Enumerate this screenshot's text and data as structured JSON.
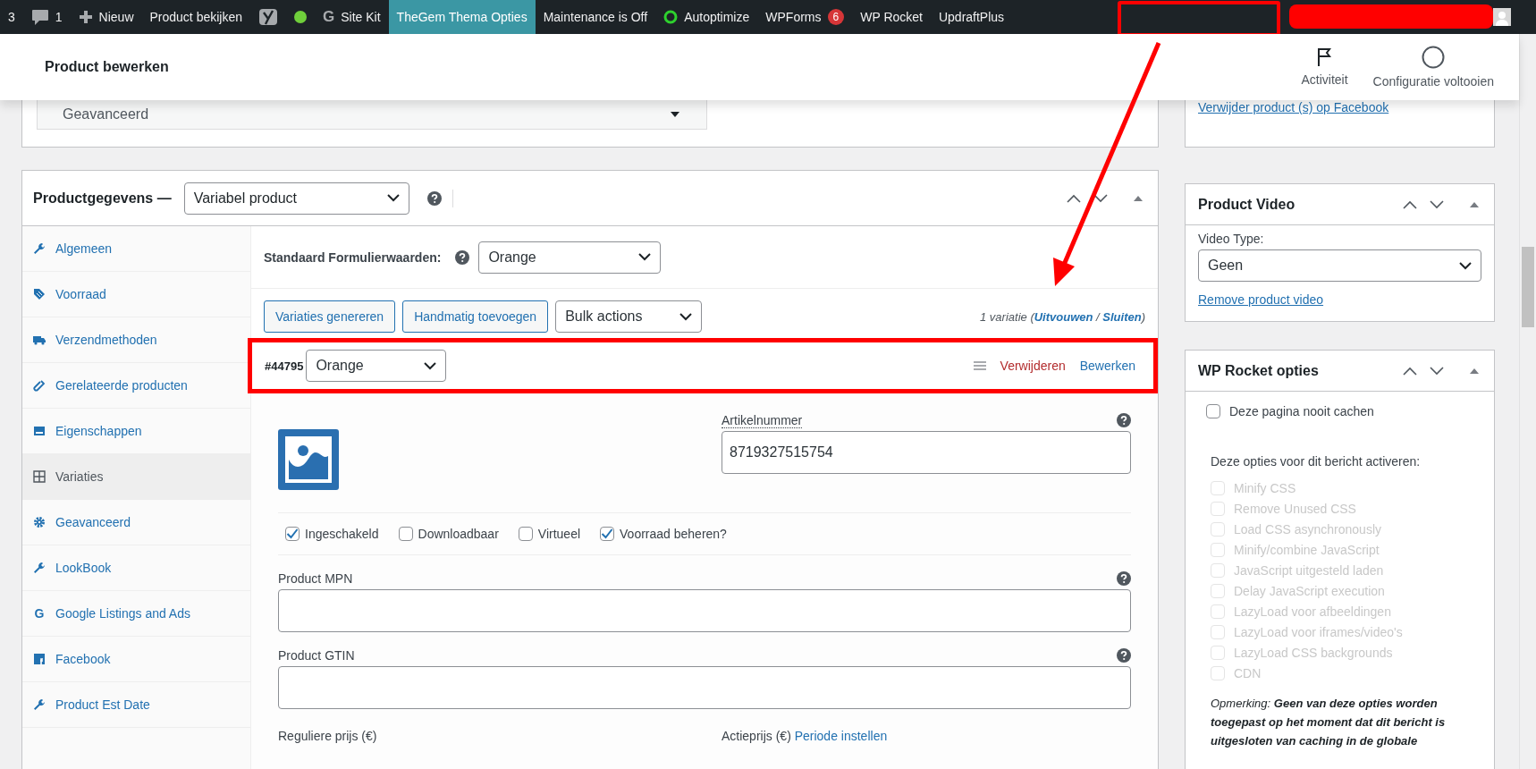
{
  "admin_bar": {
    "items": [
      {
        "kind": "text",
        "label": "3",
        "selected": false
      },
      {
        "kind": "comments",
        "label": "1",
        "selected": false
      },
      {
        "kind": "new",
        "label": "Nieuw",
        "selected": false
      },
      {
        "kind": "text",
        "label": "Product bekijken",
        "selected": false
      },
      {
        "kind": "logo",
        "selected": false
      },
      {
        "kind": "dot",
        "color": "#6fcf3b",
        "selected": false
      },
      {
        "kind": "glyph",
        "glyph": "G",
        "label": "Site Kit",
        "selected": false
      },
      {
        "kind": "text",
        "label": "TheGem Thema Opties",
        "selected": true
      },
      {
        "kind": "text",
        "label": "Maintenance is Off",
        "selected": false
      },
      {
        "kind": "ring",
        "label": "Autoptimize",
        "selected": false
      },
      {
        "kind": "badge",
        "label": "WPForms",
        "badge": "6",
        "selected": false
      },
      {
        "kind": "text",
        "label": "WP Rocket",
        "selected": false
      },
      {
        "kind": "text",
        "label": "UpdraftPlus",
        "selected": false
      }
    ]
  },
  "header": {
    "title": "Product bewerken",
    "actions": [
      {
        "kind": "flag",
        "label": "Activiteit"
      },
      {
        "kind": "progress",
        "label": "Configuratie voltooien"
      }
    ]
  },
  "top_select": {
    "value": "Geavanceerd"
  },
  "facebook_box": {
    "link": "Verwijder product (s) op Facebook"
  },
  "product_data": {
    "title": "Productgegevens —",
    "type_value": "Variabel product",
    "tabs": [
      {
        "kind": "wrench",
        "label": "Algemeen",
        "selected": false
      },
      {
        "kind": "tag",
        "label": "Voorraad",
        "selected": false
      },
      {
        "kind": "truck",
        "label": "Verzendmethoden",
        "selected": false
      },
      {
        "kind": "link",
        "label": "Gerelateerde producten",
        "selected": false
      },
      {
        "kind": "card",
        "label": "Eigenschappen",
        "selected": false
      },
      {
        "kind": "grid",
        "label": "Variaties",
        "selected": true
      },
      {
        "kind": "gear",
        "label": "Geavanceerd",
        "selected": false
      },
      {
        "kind": "wrench",
        "label": "LookBook",
        "selected": false
      },
      {
        "kind": "glyph",
        "glyph": "G",
        "label": "Google Listings and Ads",
        "selected": false
      },
      {
        "kind": "square",
        "label": "Facebook",
        "selected": false
      },
      {
        "kind": "wrench",
        "label": "Product Est Date",
        "selected": false
      }
    ],
    "defaults_label": "Standaard Formulierwaarden:",
    "defaults_value": "Orange",
    "buttons": [
      "Variaties genereren",
      "Handmatig toevoegen"
    ],
    "bulk_value": "Bulk actions",
    "count": {
      "text": "1 variatie (",
      "expand": "Uitvouwen",
      "separator": " / ",
      "collapse": "Sluiten",
      "end": ")"
    },
    "variation": {
      "id": "#44795",
      "value": "Orange",
      "remove": "Verwijderen",
      "edit": "Bewerken",
      "sku_label": "Artikelnummer",
      "sku": "8719327515754",
      "options": [
        {
          "label": "Ingeschakeld",
          "checked": true
        },
        {
          "label": "Downloadbaar",
          "checked": false
        },
        {
          "label": "Virtueel",
          "checked": false
        },
        {
          "label": "Voorraad beheren?",
          "checked": true
        }
      ],
      "fields": [
        {
          "label": "Product MPN"
        },
        {
          "label": "Product GTIN"
        }
      ],
      "regular_price_label": "Reguliere prijs (€)",
      "sale_price_label": "Actieprijs (€)",
      "schedule_link": "Periode instellen"
    }
  },
  "product_video": {
    "title": "Product Video",
    "label": "Video Type:",
    "value": "Geen",
    "link": "Remove product video"
  },
  "wp_rocket": {
    "title": "WP Rocket opties",
    "never_cache": {
      "label": "Deze pagina nooit cachen",
      "checked": false
    },
    "intro": "Deze opties voor dit bericht activeren:",
    "options": [
      {
        "label": "Minify CSS",
        "checked": false,
        "disabled": true
      },
      {
        "label": "Remove Unused CSS",
        "checked": false,
        "disabled": true
      },
      {
        "label": "Load CSS asynchronously",
        "checked": false,
        "disabled": true
      },
      {
        "label": "Minify/combine JavaScript",
        "checked": false,
        "disabled": true
      },
      {
        "label": "JavaScript uitgesteld laden",
        "checked": false,
        "disabled": true
      },
      {
        "label": "Delay JavaScript execution",
        "checked": false,
        "disabled": true
      },
      {
        "label": "LazyLoad voor afbeeldingen",
        "checked": false,
        "disabled": true
      },
      {
        "label": "LazyLoad voor iframes/video's",
        "checked": false,
        "disabled": true
      },
      {
        "label": "LazyLoad CSS backgrounds",
        "checked": false,
        "disabled": true
      },
      {
        "label": "CDN",
        "checked": false,
        "disabled": true
      }
    ],
    "note": "Opmerking: **Geen van deze opties worden toegepast op het moment dat dit bericht is uitgesloten van caching in de globale**"
  }
}
